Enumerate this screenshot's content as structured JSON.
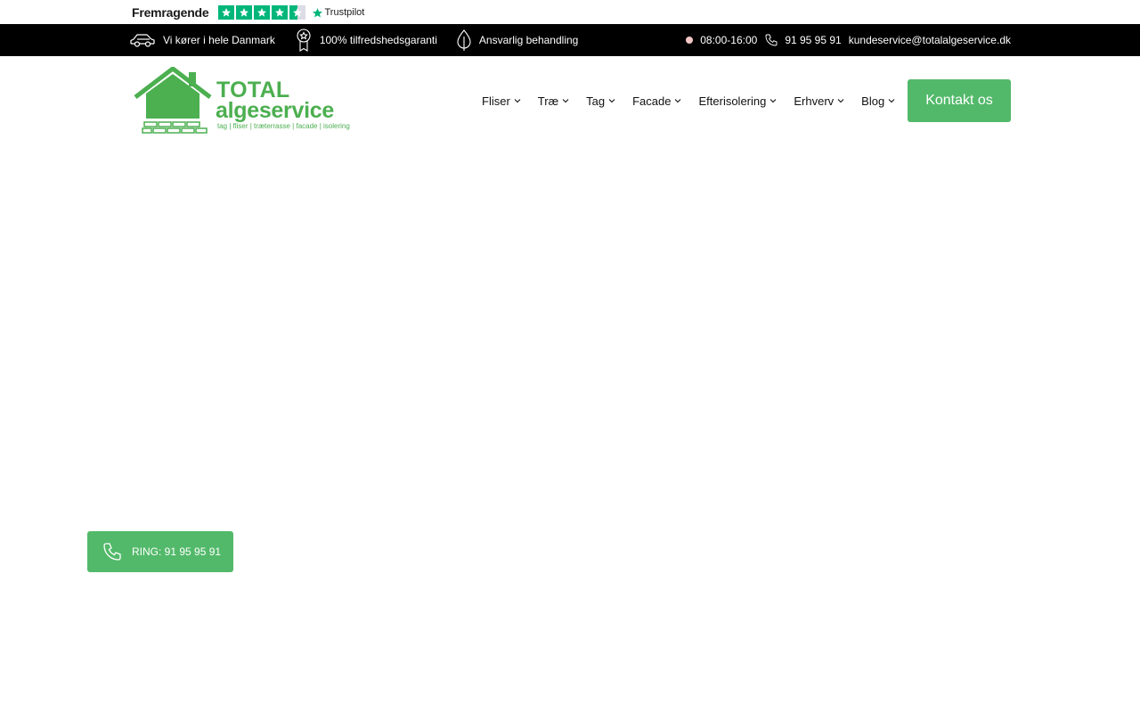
{
  "trustpilot": {
    "rating_text": "Fremragende",
    "stars": 4.5,
    "brand": "Trustpilot",
    "color": "#00b67a"
  },
  "info_bar": {
    "items": [
      {
        "icon": "car-icon",
        "label": "Vi kører i hele Danmark"
      },
      {
        "icon": "award-icon",
        "label": "100% tilfredshedsgaranti"
      },
      {
        "icon": "leaf-icon",
        "label": "Ansvarlig behandling"
      }
    ],
    "hours": "08:00-16:00",
    "phone": "91 95 95 91",
    "email": "kundeservice@totalalgeservice.dk"
  },
  "header": {
    "logo": {
      "title": "TOTAL",
      "subtitle": "algeservice",
      "tagline": "tag | fliser | træterrasse | facade | isolering",
      "color": "#4caf50"
    },
    "nav": [
      {
        "label": "Fliser"
      },
      {
        "label": "Træ"
      },
      {
        "label": "Tag"
      },
      {
        "label": "Facade"
      },
      {
        "label": "Efterisolering"
      },
      {
        "label": "Erhverv"
      },
      {
        "label": "Blog"
      }
    ],
    "cta_label": "Kontakt os",
    "accent": "#52b96a"
  },
  "floating_call": {
    "label": "RING: 91 95 95 91",
    "icon": "phone-icon"
  }
}
